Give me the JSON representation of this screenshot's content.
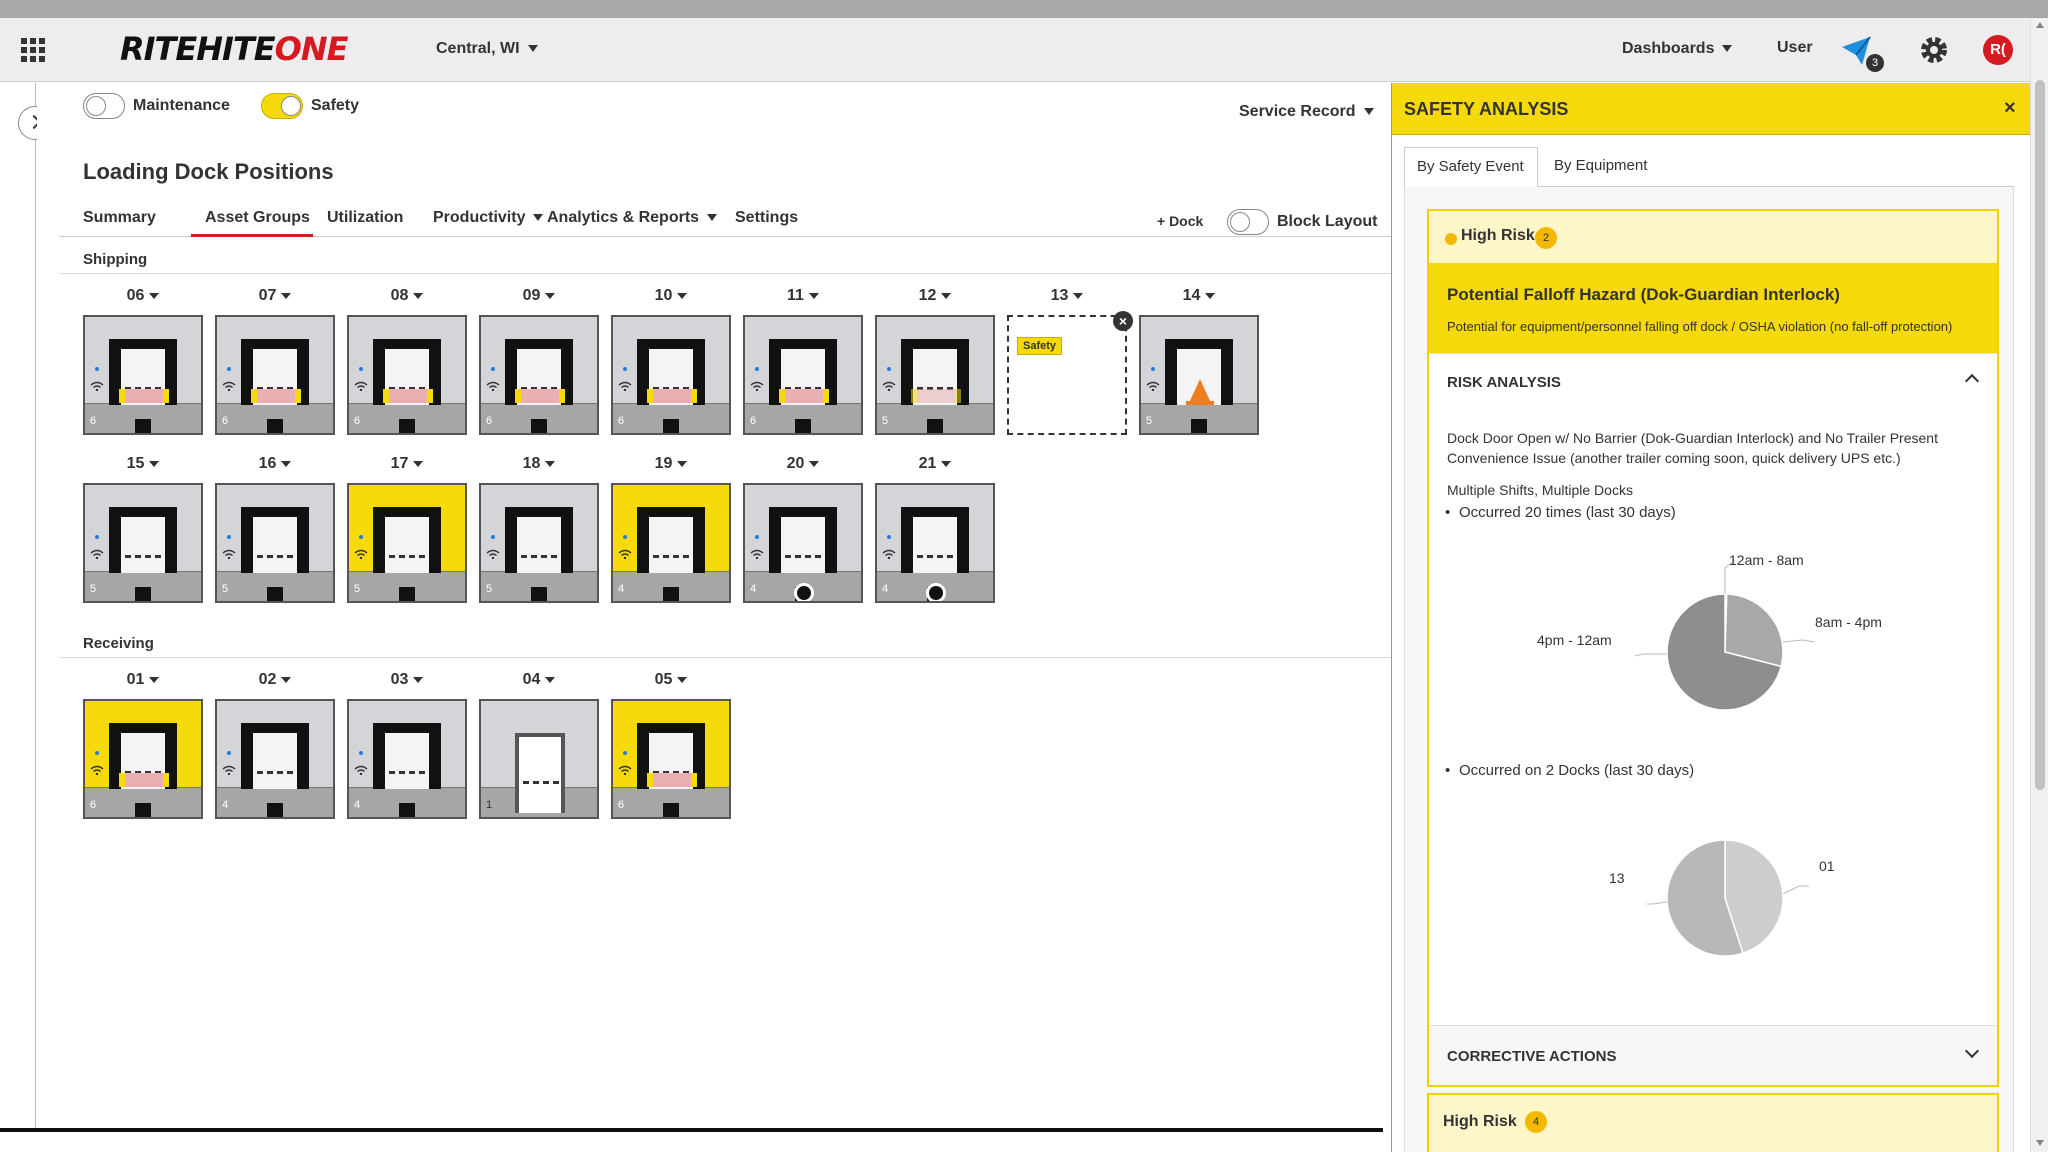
{
  "header": {
    "logo_prefix": "RITEHITE",
    "logo_suffix": "ONE",
    "location": "Central, WI",
    "dashboards_label": "Dashboards",
    "user_label": "User",
    "notification_count": "3",
    "avatar_initials": "R(",
    "icons": [
      "apps-grid-icon",
      "notification-icon",
      "gear-icon",
      "avatar"
    ]
  },
  "filters": {
    "maintenance_label": "Maintenance",
    "maintenance_on": false,
    "safety_label": "Safety",
    "safety_on": true,
    "service_record_label": "Service Record"
  },
  "page": {
    "title": "Loading Dock Positions"
  },
  "tabs": [
    {
      "label": "Summary",
      "active": false
    },
    {
      "label": "Asset Groups",
      "active": true
    },
    {
      "label": "Utilization",
      "active": false
    },
    {
      "label": "Productivity",
      "active": false,
      "dropdown": true
    },
    {
      "label": "Analytics & Reports",
      "active": false,
      "dropdown": true
    },
    {
      "label": "Settings",
      "active": false
    }
  ],
  "toolbar": {
    "add_dock_label": "+ Dock",
    "block_layout_label": "Block Layout",
    "block_layout_on": false
  },
  "shipping": {
    "label": "Shipping",
    "docks": [
      {
        "num": "06",
        "count": "6",
        "state": "barrier"
      },
      {
        "num": "07",
        "count": "6",
        "state": "barrier"
      },
      {
        "num": "08",
        "count": "6",
        "state": "barrier"
      },
      {
        "num": "09",
        "count": "6",
        "state": "barrier"
      },
      {
        "num": "10",
        "count": "6",
        "state": "barrier"
      },
      {
        "num": "11",
        "count": "6",
        "state": "barrier"
      },
      {
        "num": "12",
        "count": "5",
        "state": "barrier-light"
      },
      {
        "num": "13",
        "count": "",
        "state": "empty",
        "tag": "Safety"
      },
      {
        "num": "14",
        "count": "5",
        "state": "cone"
      },
      {
        "num": "15",
        "count": "5",
        "state": "closed"
      },
      {
        "num": "16",
        "count": "5",
        "state": "closed"
      },
      {
        "num": "17",
        "count": "5",
        "state": "closed-yellow"
      },
      {
        "num": "18",
        "count": "5",
        "state": "closed"
      },
      {
        "num": "19",
        "count": "4",
        "state": "closed-yellow"
      },
      {
        "num": "20",
        "count": "4",
        "state": "wheel"
      },
      {
        "num": "21",
        "count": "4",
        "state": "wheel"
      }
    ]
  },
  "receiving": {
    "label": "Receiving",
    "docks": [
      {
        "num": "01",
        "count": "6",
        "state": "barrier-yellow"
      },
      {
        "num": "02",
        "count": "4",
        "state": "closed"
      },
      {
        "num": "03",
        "count": "4",
        "state": "closed"
      },
      {
        "num": "04",
        "count": "1",
        "state": "open"
      },
      {
        "num": "05",
        "count": "6",
        "state": "barrier-yellow"
      }
    ]
  },
  "panel": {
    "title": "SAFETY ANALYSIS",
    "close_icon": "close-icon",
    "tabs": [
      {
        "label": "By Safety Event",
        "active": true
      },
      {
        "label": "By Equipment",
        "active": false
      }
    ],
    "card1": {
      "risk_label": "High Risk",
      "risk_count": "2",
      "hazard_title": "Potential Falloff Hazard (Dok-Guardian Interlock)",
      "hazard_desc": "Potential for equipment/personnel falling off dock / OSHA violation (no fall-off protection)",
      "risk_analysis_title": "RISK ANALYSIS",
      "line1": "Dock Door Open w/ No Barrier (Dok-Guardian Interlock) and No Trailer Present",
      "line2": "Convenience Issue (another trailer coming soon, quick delivery UPS etc.)",
      "line3": "Multiple Shifts, Multiple Docks",
      "bullet1": "Occurred 20 times (last 30 days)",
      "bullet2": "Occurred on 2 Docks (last 30 days)",
      "corrective_actions_title": "CORRECTIVE ACTIONS"
    },
    "card2": {
      "risk_label": "High Risk",
      "risk_count": "4"
    }
  },
  "chart_data": [
    {
      "type": "pie",
      "title": "",
      "categories": [
        "12am - 8am",
        "8am - 4pm",
        "4pm - 12am"
      ],
      "values": [
        0.5,
        28.5,
        71
      ],
      "colors": [
        "#8a8a8a",
        "#a8a8a8",
        "#8e8e8e"
      ]
    },
    {
      "type": "pie",
      "title": "",
      "categories": [
        "01",
        "13"
      ],
      "values": [
        45,
        55
      ],
      "colors": [
        "#cdcdcd",
        "#b8b8b8"
      ]
    }
  ]
}
